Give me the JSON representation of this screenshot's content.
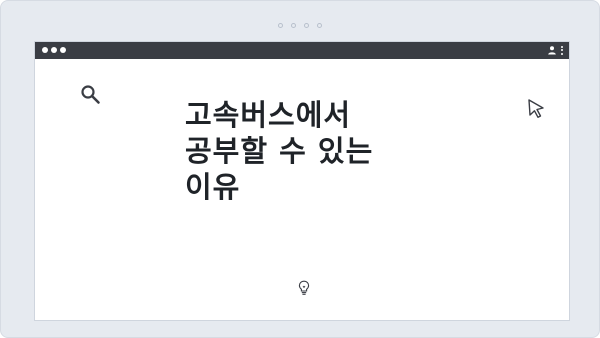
{
  "article": {
    "title_lines": [
      "고속버스에서",
      "공부할 수 있는",
      "이유"
    ]
  },
  "icons": {
    "search": "search-icon",
    "cursor": "cursor-arrow-icon",
    "lightbulb": "lightbulb-icon",
    "user": "user-icon",
    "menu": "more-vertical-icon"
  },
  "colors": {
    "background": "#e6eaf0",
    "titlebar": "#3a3d44",
    "title_text": "#1f2328"
  }
}
